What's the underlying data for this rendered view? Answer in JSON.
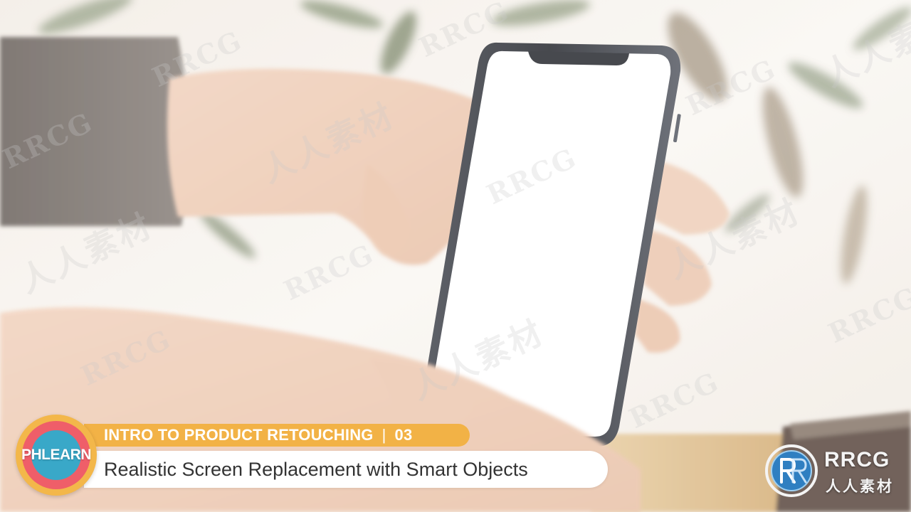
{
  "watermark": {
    "latin": "RRCG",
    "cjk": "人人素材"
  },
  "lower_third": {
    "brand": "PHLEARN",
    "series": "INTRO TO PRODUCT RETOUCHING",
    "separator": "|",
    "episode": "03",
    "title": "Realistic Screen Replacement with Smart Objects"
  },
  "corner_logo": {
    "latin": "RRCG",
    "cjk": "人人素材"
  },
  "colors": {
    "series_bar": "#f2b246",
    "badge_outer": "#f3b74a",
    "badge_mid": "#ef5e69",
    "badge_inner": "#39a8c8",
    "title_bar": "#ffffff",
    "title_text": "#333333"
  }
}
